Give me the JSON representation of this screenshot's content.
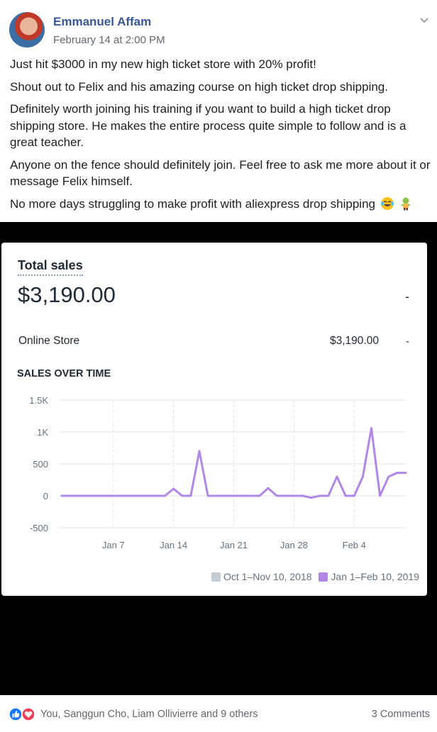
{
  "post": {
    "author": "Emmanuel Affam",
    "timestamp": "February 14 at 2:00 PM",
    "paragraphs": [
      "Just hit $3000 in my new high ticket store with 20% profit!",
      "Shout out to Felix and his amazing course on high ticket drop shipping.",
      "Definitely worth joining his training if you want to build a high ticket drop shipping store. He makes the entire process quite simple to follow and is a great teacher.",
      "Anyone on the fence should definitely join. Feel free to ask me more about it or message Felix himself.",
      "No more days struggling to make profit with aliexpress drop shipping"
    ],
    "emojis": [
      "face-with-tears-of-joy-icon",
      "zombie-icon"
    ]
  },
  "card": {
    "total_sales_title": "Total sales",
    "total_sales_value": "$3,190.00",
    "total_sales_dash": "-",
    "online_store_label": "Online Store",
    "online_store_value": "$3,190.00",
    "online_store_dash": "-",
    "sales_over_time_title": "SALES OVER TIME"
  },
  "chart_data": {
    "type": "line",
    "title": "SALES OVER TIME",
    "xlabel": "",
    "ylabel": "",
    "ylim": [
      -500,
      1500
    ],
    "yticks": [
      1500,
      1000,
      500,
      0,
      -500
    ],
    "ytick_labels": [
      "1.5K",
      "1K",
      "500",
      "0",
      "-500"
    ],
    "xticks": [
      7,
      14,
      21,
      28,
      35
    ],
    "xtick_labels": [
      "Jan 7",
      "Jan 14",
      "Jan 21",
      "Jan 28",
      "Feb 4"
    ],
    "grid": true,
    "legend": "bottom-right",
    "series": [
      {
        "name": "Oct 1–Nov 10, 2018",
        "color": "#c4cdd5",
        "x": [],
        "values": []
      },
      {
        "name": "Jan 1–Feb 10, 2019",
        "color": "#b087e4",
        "x": [
          1,
          2,
          3,
          4,
          5,
          6,
          7,
          8,
          9,
          10,
          11,
          12,
          13,
          14,
          15,
          16,
          17,
          18,
          19,
          20,
          21,
          22,
          23,
          24,
          25,
          26,
          27,
          28,
          29,
          30,
          31,
          32,
          33,
          34,
          35,
          36,
          37,
          38,
          39,
          40,
          41
        ],
        "values": [
          0,
          0,
          0,
          0,
          0,
          0,
          0,
          0,
          0,
          0,
          0,
          0,
          0,
          110,
          0,
          0,
          700,
          0,
          0,
          0,
          0,
          0,
          0,
          0,
          120,
          0,
          0,
          0,
          0,
          -30,
          0,
          0,
          300,
          0,
          0,
          300,
          1060,
          0,
          300,
          360,
          360
        ]
      }
    ]
  },
  "footer": {
    "reaction_names": "You, Sanggun Cho, Liam Ollivierre and 9 others",
    "comments": "3 Comments"
  },
  "colors": {
    "author_link": "#385898",
    "like_blue": "#1877f2",
    "love_red": "#f33e58",
    "line_purple": "#b087e4",
    "previous_grey": "#c4cdd5"
  }
}
